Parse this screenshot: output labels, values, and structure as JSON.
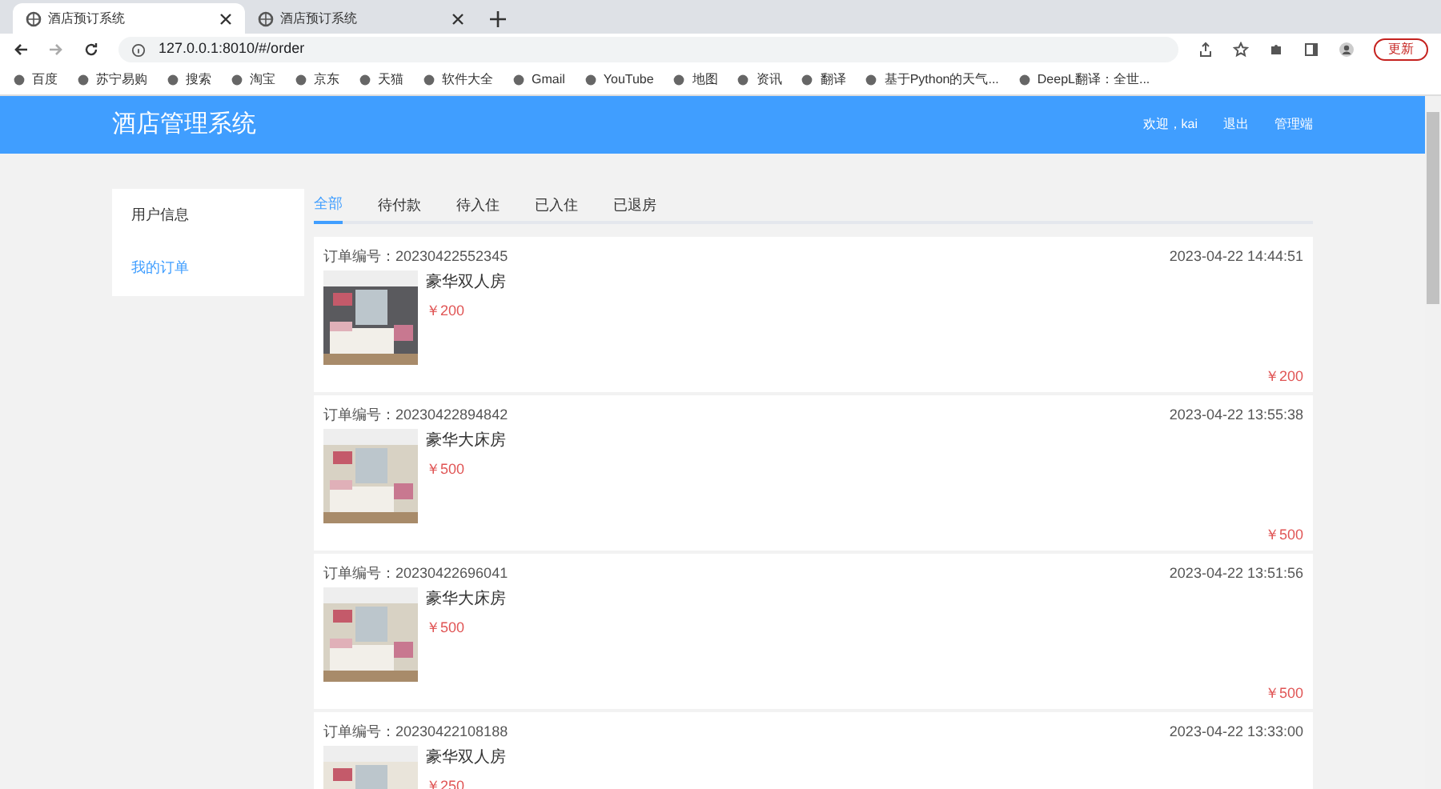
{
  "browser": {
    "tabs": [
      {
        "title": "酒店预订系统",
        "selected": true
      },
      {
        "title": "酒店预订系统",
        "selected": false
      }
    ],
    "url": "127.0.0.1:8010/#/order",
    "update_button": "更新",
    "bookmarks": [
      "百度",
      "苏宁易购",
      "搜索",
      "淘宝",
      "京东",
      "天猫",
      "软件大全",
      "Gmail",
      "YouTube",
      "地图",
      "资讯",
      "翻译",
      "基于Python的天气...",
      "DeepL翻译：全世..."
    ]
  },
  "header": {
    "title": "酒店管理系统",
    "welcome": "欢迎，kai",
    "logout": "退出",
    "admin": "管理端"
  },
  "sidebar": {
    "items": [
      {
        "label": "用户信息",
        "selected": false
      },
      {
        "label": "我的订单",
        "selected": true
      }
    ]
  },
  "tabs": [
    {
      "label": "全部",
      "selected": true
    },
    {
      "label": "待付款",
      "selected": false
    },
    {
      "label": "待入住",
      "selected": false
    },
    {
      "label": "已入住",
      "selected": false
    },
    {
      "label": "已退房",
      "selected": false
    }
  ],
  "orders": [
    {
      "number": "订单编号：20230422552345",
      "time": "2023-04-22 14:44:51",
      "room": "豪华双人房",
      "price": "￥200",
      "total": "￥200"
    },
    {
      "number": "订单编号：20230422894842",
      "time": "2023-04-22 13:55:38",
      "room": "豪华大床房",
      "price": "￥500",
      "total": "￥500"
    },
    {
      "number": "订单编号：20230422696041",
      "time": "2023-04-22 13:51:56",
      "room": "豪华大床房",
      "price": "￥500",
      "total": "￥500"
    },
    {
      "number": "订单编号：20230422108188",
      "time": "2023-04-22 13:33:00",
      "room": "豪华双人房",
      "price": "￥250"
    }
  ]
}
